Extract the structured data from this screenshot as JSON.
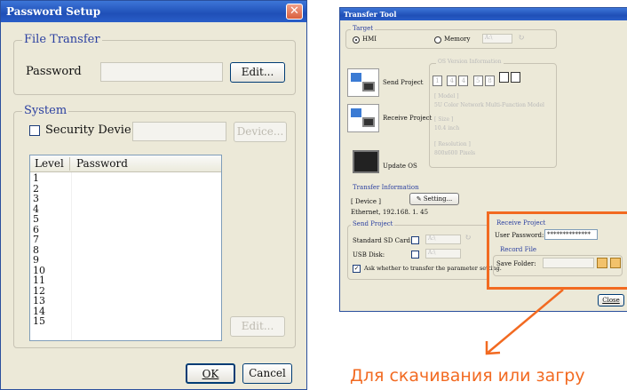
{
  "left_dialog": {
    "title": "Password Setup",
    "file_transfer_group": "File Transfer",
    "password_label": "Password",
    "edit_button": "Edit...",
    "system_group": "System",
    "security_label": "Security Devie",
    "device_button": "Device...",
    "table_headers": [
      "Level",
      "Password"
    ],
    "levels": [
      "1",
      "2",
      "3",
      "4",
      "5",
      "6",
      "7",
      "8",
      "9",
      "10",
      "11",
      "12",
      "13",
      "14",
      "15"
    ],
    "edit_button_2": "Edit...",
    "ok_button": "OK",
    "cancel_button": "Cancel"
  },
  "right_dialog": {
    "title": "Transfer Tool",
    "target_group": "Target",
    "hmi_option": "HMI",
    "memory_option": "Memory",
    "memory_value": "A:\\",
    "send_project": "Send Project",
    "receive_project": "Receive Project",
    "update_os": "Update OS",
    "os_group": "OS Version Information",
    "os_version_digits": [
      "1",
      "4",
      "4",
      "5",
      "8"
    ],
    "model_label": "[ Model ]",
    "model_value": "5U Color Network Multi-Function Model",
    "size_label": "[ Size ]",
    "size_value": "10.4 inch",
    "resolution_label": "[ Resolution ]",
    "resolution_value": "800x600 Pixels",
    "transfer_info_group": "Transfer Information",
    "device_label": "[ Device ]",
    "setting_button": "Setting...",
    "device_address": "Ethernet, 192.168. 1. 45",
    "send_project_group": "Send Project",
    "sd_card_label": "Standard SD Card:",
    "usb_disk_label": "USB Disk:",
    "sd_value": "A:\\",
    "usb_value": "A:\\",
    "ask_label": "Ask whether to transfer the parameter setting.",
    "receive_group": "Receive Project",
    "user_password_label": "User Password:",
    "user_password_value": "**************",
    "record_file_group": "Record File",
    "save_folder_label": "Save Folder:",
    "close_button": "Close"
  },
  "annotation": {
    "caption": "Для скачивания или загру",
    "color": "#f26a21"
  }
}
